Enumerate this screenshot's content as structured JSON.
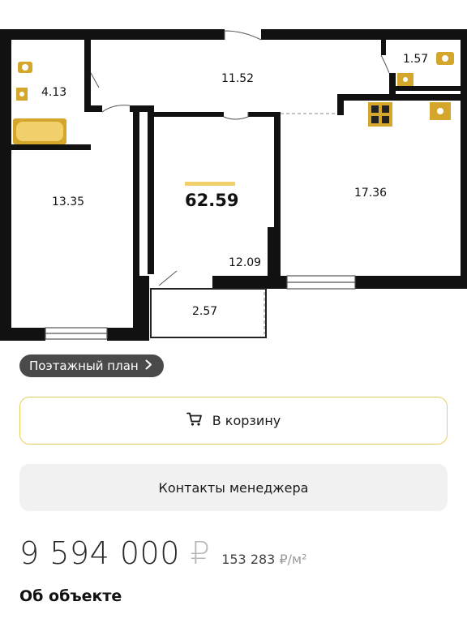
{
  "plan": {
    "rooms": [
      {
        "id": "bathroom",
        "area": "4.13"
      },
      {
        "id": "hallway",
        "area": "11.52"
      },
      {
        "id": "toilet",
        "area": "1.57"
      },
      {
        "id": "bedroom",
        "area": "13.35"
      },
      {
        "id": "living-room",
        "area": "12.09"
      },
      {
        "id": "kitchen",
        "area": "17.36"
      },
      {
        "id": "balcony",
        "area": "2.57"
      }
    ],
    "total_area": "62.59",
    "accent_color": "#f2d06b",
    "fixture_color": "#d4a72c"
  },
  "floor_plan_link": {
    "label": "Поэтажный план",
    "icon": "chevron-right-icon"
  },
  "cart_button": {
    "label": "В корзину",
    "icon": "cart-icon"
  },
  "manager_button": {
    "label": "Контакты менеджера"
  },
  "price": {
    "amount": "9 594 000",
    "currency": "₽",
    "per_m_value": "153 283",
    "per_m_unit": "₽/м²"
  },
  "section_title": "Об объекте"
}
